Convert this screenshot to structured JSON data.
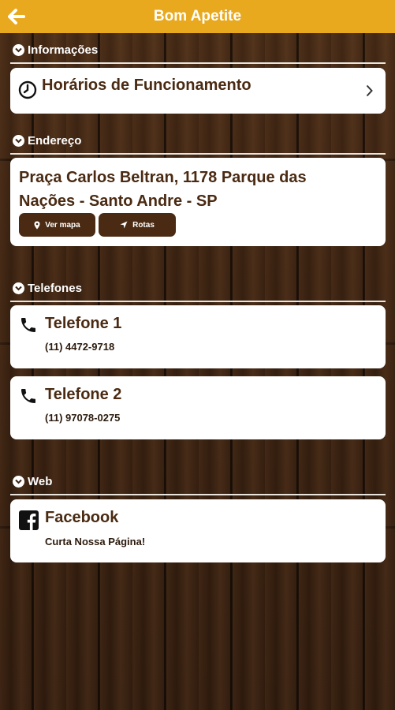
{
  "header": {
    "title": "Bom Apetite",
    "back_icon": "arrow-left-icon"
  },
  "colors": {
    "header_bg": "#e8a91f",
    "accent_brown": "#4a2a12",
    "card_bg": "#ffffff"
  },
  "sections": {
    "info": {
      "title": "Informações",
      "hours_label": "Horários de Funcionamento"
    },
    "address": {
      "title": "Endereço",
      "text": "Praça Carlos Beltran, 1178 Parque das Nações - Santo Andre - SP",
      "map_button": "Ver mapa",
      "routes_button": "Rotas"
    },
    "phones": {
      "title": "Telefones",
      "items": [
        {
          "label": "Telefone 1",
          "number": "(11) 4472-9718"
        },
        {
          "label": "Telefone 2",
          "number": "(11) 97078-0275"
        }
      ]
    },
    "web": {
      "title": "Web",
      "facebook_label": "Facebook",
      "facebook_sub": "Curta Nossa Página!"
    }
  }
}
